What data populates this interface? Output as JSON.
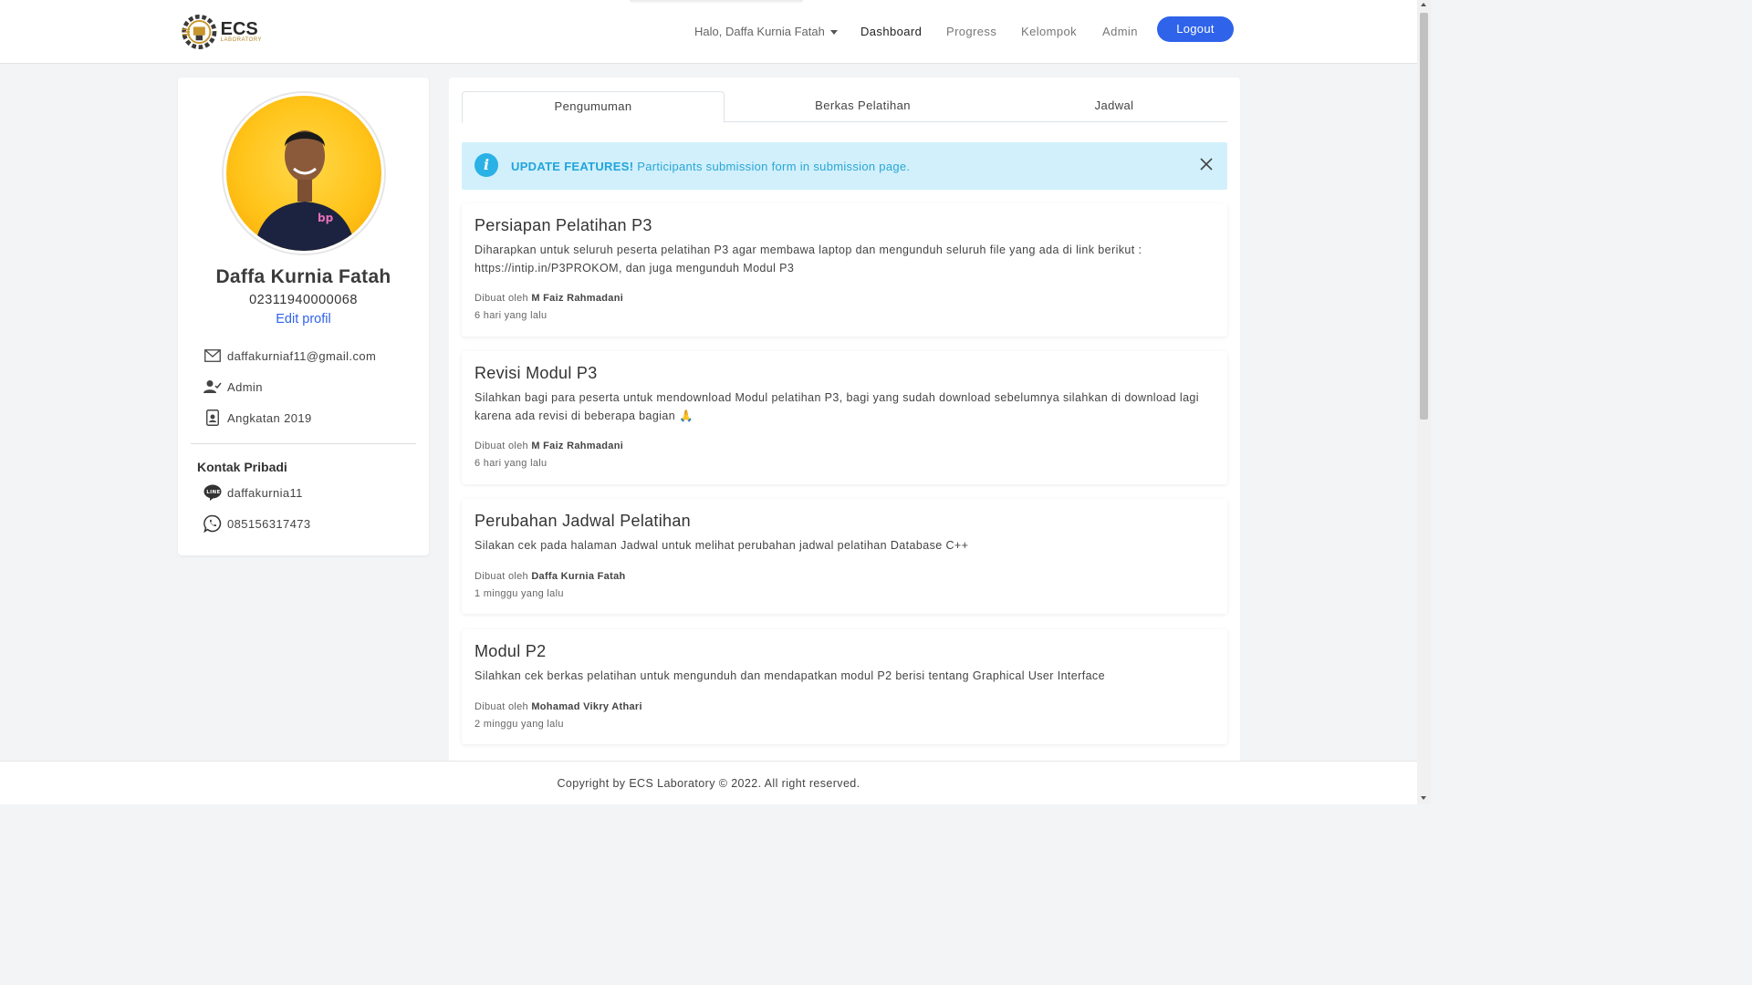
{
  "navbar": {
    "logo_text": "ECS",
    "logo_sub": "LABORATORY",
    "user_greeting": "Halo, Daffa Kurnia Fatah",
    "links": [
      "Dashboard",
      "Progress",
      "Kelompok",
      "Admin"
    ],
    "active_link": "Dashboard",
    "logout_label": "Logout",
    "accent_color": "#2f63ea"
  },
  "profile": {
    "name": "Daffa Kurnia Fatah",
    "nim": "02311940000068",
    "edit_label": "Edit profil",
    "email": "daffakurniaf11@gmail.com",
    "role": "Admin",
    "angkatan": "Angkatan 2019",
    "kontak_title": "Kontak Pribadi",
    "line_id": "daffakurnia11",
    "whatsapp": "085156317473"
  },
  "tabs": [
    "Pengumuman",
    "Berkas Pelatihan",
    "Jadwal"
  ],
  "active_tab": "Pengumuman",
  "alert": {
    "bold": "UPDATE FEATURES!",
    "text": "Participants submission form in submission page.",
    "color": "#d1f0fb"
  },
  "posts": [
    {
      "title": "Persiapan Pelatihan P3",
      "body": "Diharapkan untuk seluruh peserta pelatihan P3 agar membawa laptop dan mengunduh seluruh file yang ada di link berikut : https://intip.in/P3PROKOM, dan juga mengunduh Modul P3",
      "by_label": "Dibuat oleh",
      "author": "M Faiz Rahmadani",
      "time": "6 hari yang lalu"
    },
    {
      "title": "Revisi Modul P3",
      "body": "Silahkan bagi para peserta untuk mendownload Modul pelatihan P3, bagi yang sudah download sebelumnya silahkan di download lagi karena ada revisi di beberapa bagian 🙏",
      "by_label": "Dibuat oleh",
      "author": "M Faiz Rahmadani",
      "time": "6 hari yang lalu"
    },
    {
      "title": "Perubahan Jadwal Pelatihan",
      "body": "Silakan cek pada halaman Jadwal untuk melihat perubahan jadwal pelatihan Database C++",
      "by_label": "Dibuat oleh",
      "author": "Daffa Kurnia Fatah",
      "time": "1 minggu yang lalu"
    },
    {
      "title": "Modul P2",
      "body": "Silahkan cek berkas pelatihan untuk mengunduh dan mendapatkan modul P2 berisi tentang Graphical User Interface",
      "by_label": "Dibuat oleh",
      "author": "Mohamad Vikry Athari",
      "time": "2 minggu yang lalu"
    }
  ],
  "footer": "Copyright by ECS Laboratory © 2022. All right reserved."
}
